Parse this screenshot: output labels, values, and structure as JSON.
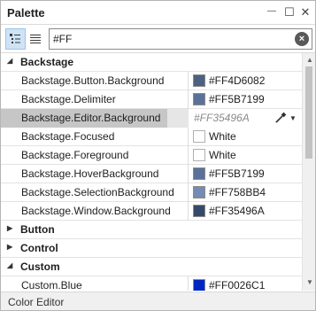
{
  "window": {
    "title": "Palette",
    "minimize": "—",
    "maximize": "☐",
    "close": "✕"
  },
  "toolbar": {
    "search_value": "#FF"
  },
  "categories": [
    {
      "name": "Backstage",
      "expanded": true,
      "arrow": "◢"
    },
    {
      "name": "Button",
      "expanded": false,
      "arrow": "▶"
    },
    {
      "name": "Control",
      "expanded": false,
      "arrow": "▶"
    },
    {
      "name": "Custom",
      "expanded": true,
      "arrow": "◢"
    }
  ],
  "properties": [
    {
      "name": "Backstage.Button.Background",
      "value": "#FF4D6082",
      "color": "#4D6082"
    },
    {
      "name": "Backstage.Delimiter",
      "value": "#FF5B7199",
      "color": "#5B7199"
    },
    {
      "name": "Backstage.Editor.Background",
      "value": "#FF35496A",
      "color": "#35496A",
      "selected": true
    },
    {
      "name": "Backstage.Focused",
      "value": "White",
      "color": "#FFFFFF"
    },
    {
      "name": "Backstage.Foreground",
      "value": "White",
      "color": "#FFFFFF"
    },
    {
      "name": "Backstage.HoverBackground",
      "value": "#FF5B7199",
      "color": "#5B7199"
    },
    {
      "name": "Backstage.SelectionBackground",
      "value": "#FF758BB4",
      "color": "#758BB4"
    },
    {
      "name": "Backstage.Window.Background",
      "value": "#FF35496A",
      "color": "#35496A"
    },
    {
      "name": "Custom.Blue",
      "value": "#FF0026C1",
      "color": "#0026C1"
    }
  ],
  "statusbar": {
    "label": "Color Editor"
  },
  "icons": {
    "categorized_view": "categorized-view-icon",
    "list_view": "list-view-icon",
    "clear": "clear-search-icon",
    "eyedropper": "eyedropper-icon",
    "dropdown": "dropdown-arrow-icon",
    "scroll_up": "▲",
    "scroll_down": "▼"
  }
}
